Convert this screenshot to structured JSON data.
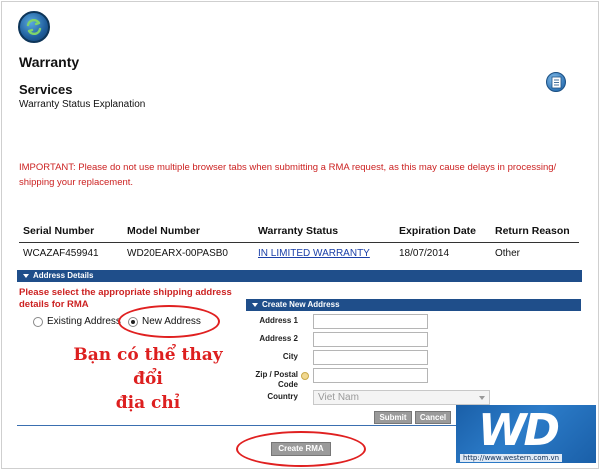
{
  "header": {
    "title": "Warranty",
    "section": "Services",
    "subtitle": "Warranty Status Explanation"
  },
  "notice": {
    "important": "IMPORTANT: Please do not use multiple browser tabs when submitting a RMA request, as this may cause delays in processing/ shipping your replacement."
  },
  "warranty_table": {
    "columns": [
      "Serial Number",
      "Model Number",
      "Warranty Status",
      "Expiration Date",
      "Return Reason"
    ],
    "row": {
      "serial": "WCAZAF459941",
      "model": "WD20EARX-00PASB0",
      "status": "IN LIMITED WARRANTY",
      "expiration": "18/07/2014",
      "reason": "Other"
    }
  },
  "address_details": {
    "title": "Address Details",
    "instruction": "Please select the appropriate shipping address details for RMA",
    "options": [
      {
        "label": "Existing Address",
        "selected": false
      },
      {
        "label": "New Address",
        "selected": true
      }
    ],
    "annotation_line1": "Bạn có thể thay đổi",
    "annotation_line2": "địa chỉ"
  },
  "new_address": {
    "title": "Create New Address",
    "fields": {
      "address1": "Address 1",
      "address2": "Address 2",
      "city": "City",
      "zip": "Zip / Postal Code",
      "country": "Country"
    },
    "country_value": "Viet Nam",
    "submit_label": "Submit",
    "cancel_label": "Cancel"
  },
  "actions": {
    "create_rma_label": "Create RMA"
  },
  "branding": {
    "logo_text": "WD",
    "url": "http://www.western.com.vn"
  },
  "colors": {
    "accent_bar": "#1f4e8a",
    "warning_text": "#cc2222",
    "annotation": "#dd1f1f"
  }
}
